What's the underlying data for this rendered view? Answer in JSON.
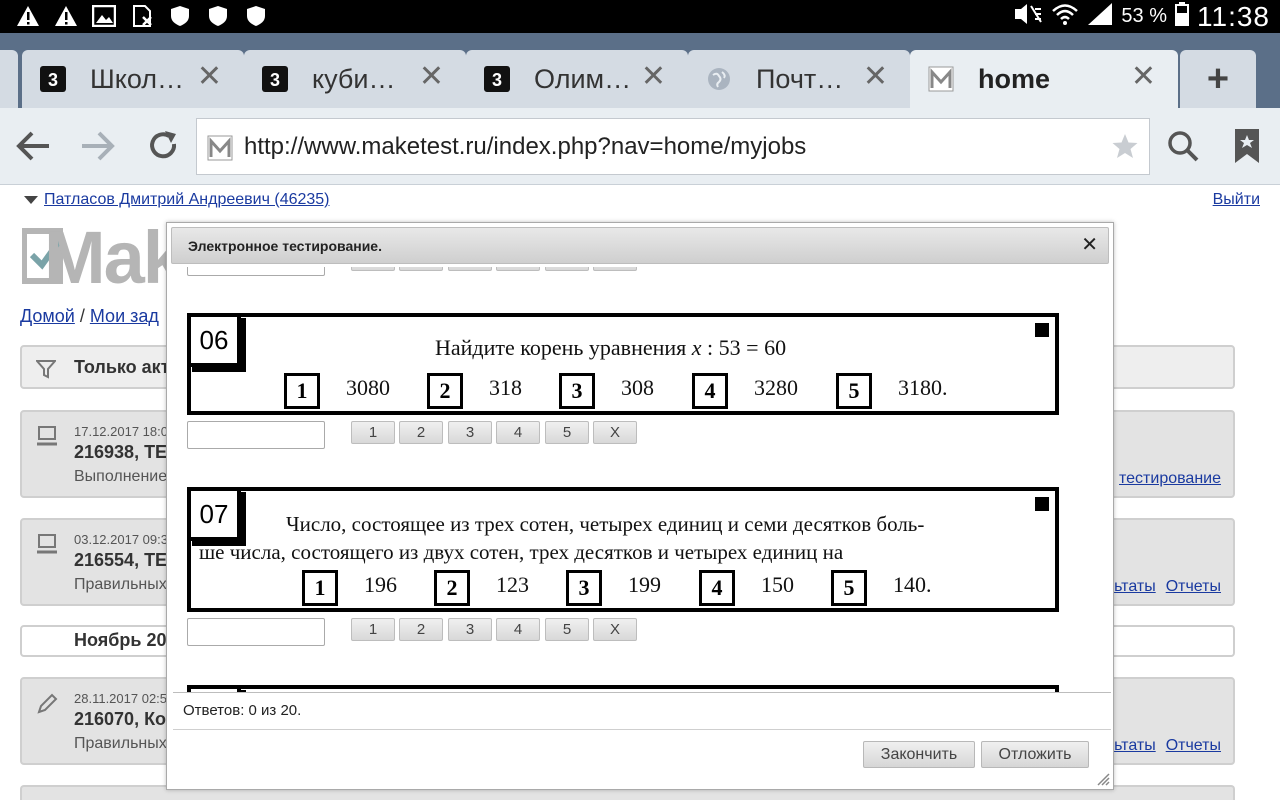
{
  "status_bar": {
    "battery_pct": "53 %",
    "time": "11:38",
    "left_icons": [
      "warning-icon",
      "warning-icon",
      "image-icon",
      "sim-icon",
      "shield-icon",
      "shield-icon",
      "shield-icon"
    ]
  },
  "tabs": [
    {
      "label": "Школ…",
      "favicon": "3"
    },
    {
      "label": "куби…",
      "favicon": "3"
    },
    {
      "label": "Олим…",
      "favicon": "3"
    },
    {
      "label": "Почт…",
      "favicon": "globe"
    },
    {
      "label": "home",
      "favicon": "M",
      "active": true
    }
  ],
  "toolbar": {
    "url": "http://www.maketest.ru/index.php?nav=home/myjobs"
  },
  "page": {
    "user": "Патласов Дмитрий Андреевич (46235)",
    "logout": "Выйти",
    "logo": "Mak",
    "breadcrumb_home": "Домой",
    "breadcrumb_sep": " / ",
    "breadcrumb_current": "Мои зад",
    "filter_label": "Только акт",
    "cards": [
      {
        "date": "17.12.2017 18:0",
        "title": "216938, ТЕ",
        "sub": "Выполнение",
        "links": [
          "тестирование"
        ]
      },
      {
        "date": "03.12.2017 09:3",
        "title": "216554, ТЕ",
        "sub": "Правильных",
        "links": [
          "ьтаты",
          "Отчеты"
        ]
      },
      {
        "date": "28.11.2017 02:5",
        "title": "216070, Ко",
        "sub": "Правильных",
        "links": [
          "ьтаты",
          "Отчеты"
        ]
      }
    ],
    "month": "Ноябрь 201"
  },
  "dialog": {
    "title": "Электронное тестирование.",
    "answers_text": "Ответов: 0 из 20.",
    "finish": "Закончить",
    "postpone": "Отложить",
    "answer_buttons": [
      "1",
      "2",
      "3",
      "4",
      "5",
      "X"
    ],
    "questions": [
      {
        "num": "06",
        "text_before": "Найдите корень уравнения ",
        "math_var": "x",
        "text_after": " : 53 = 60",
        "options": [
          "3080",
          "318",
          "308",
          "3280",
          "3180."
        ]
      },
      {
        "num": "07",
        "line1": "Число, состоящее из трех сотен, четырех единиц и семи десятков боль-",
        "line2": "ше числа, состоящего из двух сотен, трех десятков и четырех единиц на",
        "options": [
          "196",
          "123",
          "199",
          "150",
          "140."
        ]
      }
    ]
  }
}
